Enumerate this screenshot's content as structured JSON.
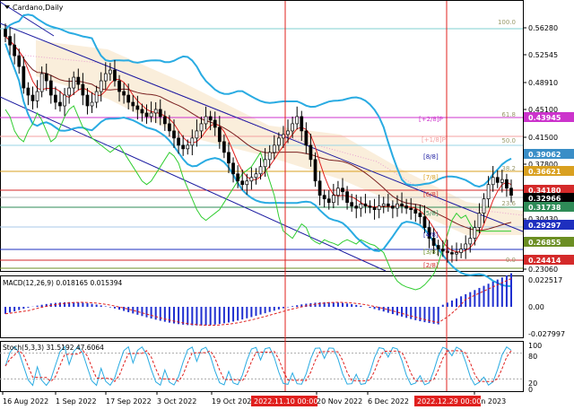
{
  "title": "Cardano,Daily",
  "price_axis": {
    "ticks": [
      "0.56280",
      "0.52545",
      "0.48910",
      "0.45100",
      "0.41500",
      "0.37800",
      "0.34165",
      "0.30430",
      "0.26855",
      "0.23060"
    ],
    "levels": [
      {
        "text": "0.43945",
        "color": "#cc33cc"
      },
      {
        "text": "0.39062",
        "color": "#3a8ec7"
      },
      {
        "text": "0.36621",
        "color": "#d9a020"
      },
      {
        "text": "0.34180",
        "color": "#d42a2a"
      },
      {
        "text": "0.32966",
        "color": "#000000"
      },
      {
        "text": "0.31738",
        "color": "#2e8b57"
      },
      {
        "text": "0.29297",
        "color": "#1e2fbf"
      },
      {
        "text": "0.26855",
        "color": "#6b8e23"
      },
      {
        "text": "0.24414",
        "color": "#d42a2a"
      }
    ]
  },
  "fib_labels": [
    "100.0",
    "61.8",
    "50.0",
    "38.2",
    "23.6",
    "0.0"
  ],
  "murrey_labels": [
    "[+2/8]P",
    "[+1/8]P",
    "[8/8]",
    "[7/8]",
    "[6/8]",
    "[5/8]",
    "[4/8]",
    "[3/8]",
    "[2/8]"
  ],
  "macd": {
    "label": "MACD(12,26,9) 0.018165 0.015394",
    "ticks": [
      "0.022517",
      "0.00",
      "-0.027997"
    ]
  },
  "stoch": {
    "label": "Stoch(5,3,3) 31.5192 47.6064",
    "ticks": [
      "100",
      "80",
      "20",
      "0"
    ]
  },
  "date_axis": {
    "labels": [
      "16 Aug 2022",
      "1 Sep 2022",
      "17 Sep 2022",
      "3 Oct 2022",
      "19 Oct 2022",
      "20 Nov 2022",
      "6 Dec 2022",
      "Jan 2023"
    ],
    "highlights": [
      "2022.11.10 00:00",
      "2022.12.29 00:00"
    ]
  },
  "colors": {
    "candles": "#000000",
    "bollinger": "#29abe2",
    "channel": "#1a1aa0",
    "vertical_lines": "#e0201e",
    "lagging": "#32cd32",
    "macd_hist": "#1f2fd0",
    "macd_signal": "#e0201e",
    "ichimoku_cloud": "#d4a86a"
  }
}
